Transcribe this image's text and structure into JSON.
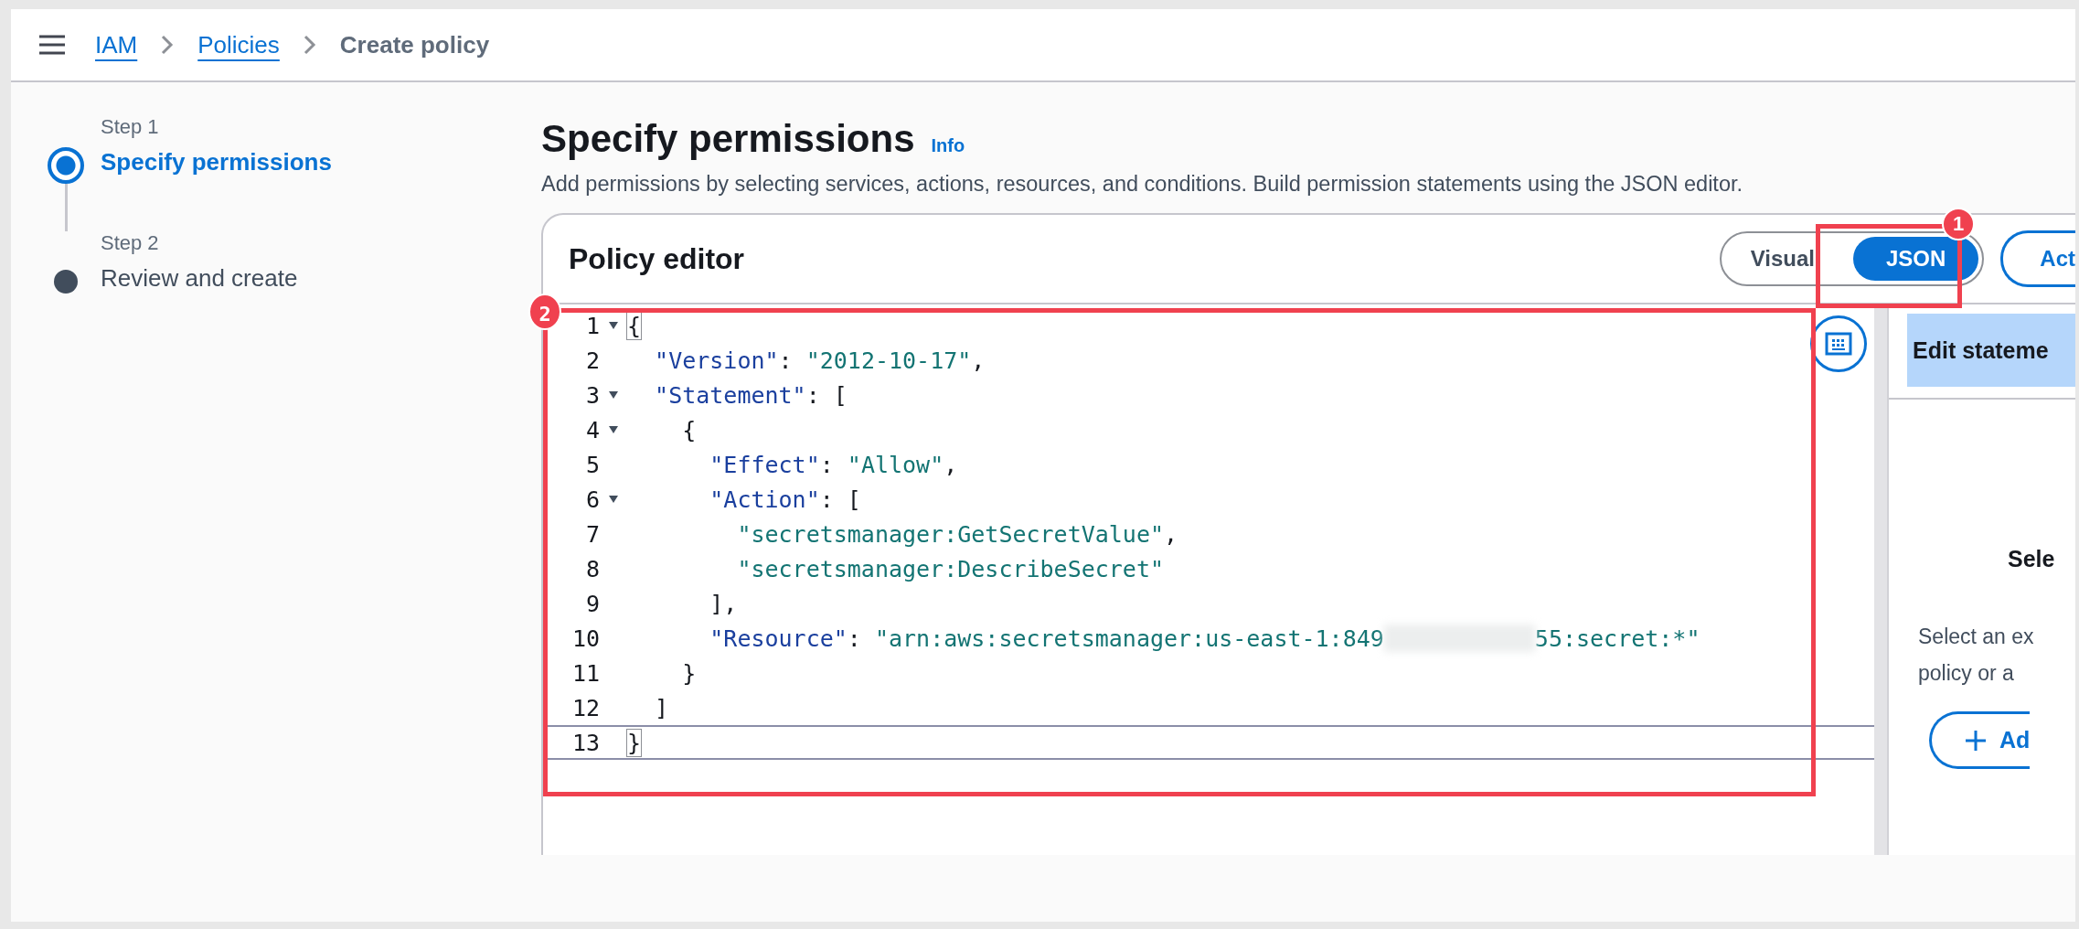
{
  "breadcrumbs": [
    {
      "label": "IAM",
      "kind": "link"
    },
    {
      "label": "Policies",
      "kind": "link"
    },
    {
      "label": "Create policy",
      "kind": "current"
    }
  ],
  "steps": [
    {
      "label": "Step 1",
      "title": "Specify permissions",
      "selected": true
    },
    {
      "label": "Step 2",
      "title": "Review and create",
      "selected": false
    }
  ],
  "page": {
    "title": "Specify permissions",
    "info_link": "Info",
    "description": "Add permissions by selecting services, actions, resources, and conditions. Build permission statements using the JSON editor."
  },
  "editor": {
    "title": "Policy editor",
    "modes": [
      {
        "label": "Visual",
        "selected": false
      },
      {
        "label": "JSON",
        "selected": true
      }
    ],
    "actions_button": "Act",
    "code_lines": [
      {
        "number": "1",
        "foldable": true,
        "active": false,
        "tokens": [
          {
            "kind": "bracket-match",
            "text": "{"
          }
        ]
      },
      {
        "number": "2",
        "foldable": false,
        "active": false,
        "tokens": [
          {
            "kind": "key",
            "text": "\"Version\""
          },
          {
            "kind": "plain",
            "text": ": "
          },
          {
            "kind": "string",
            "text": "\"2012-10-17\""
          },
          {
            "kind": "plain",
            "text": ","
          }
        ]
      },
      {
        "number": "3",
        "foldable": true,
        "active": false,
        "tokens": [
          {
            "kind": "key",
            "text": "\"Statement\""
          },
          {
            "kind": "plain",
            "text": ": ["
          }
        ]
      },
      {
        "number": "4",
        "foldable": true,
        "active": false,
        "tokens": [
          {
            "kind": "plain",
            "text": "{"
          }
        ]
      },
      {
        "number": "5",
        "foldable": false,
        "active": false,
        "tokens": [
          {
            "kind": "key",
            "text": "\"Effect\""
          },
          {
            "kind": "plain",
            "text": ": "
          },
          {
            "kind": "string",
            "text": "\"Allow\""
          },
          {
            "kind": "plain",
            "text": ","
          }
        ]
      },
      {
        "number": "6",
        "foldable": true,
        "active": false,
        "tokens": [
          {
            "kind": "key",
            "text": "\"Action\""
          },
          {
            "kind": "plain",
            "text": ": ["
          }
        ]
      },
      {
        "number": "7",
        "foldable": false,
        "active": false,
        "tokens": [
          {
            "kind": "string",
            "text": "\"secretsmanager:GetSecretValue\""
          },
          {
            "kind": "plain",
            "text": ","
          }
        ]
      },
      {
        "number": "8",
        "foldable": false,
        "active": false,
        "tokens": [
          {
            "kind": "string",
            "text": "\"secretsmanager:DescribeSecret\""
          }
        ]
      },
      {
        "number": "9",
        "foldable": false,
        "active": false,
        "tokens": [
          {
            "kind": "plain",
            "text": "],"
          }
        ]
      },
      {
        "number": "10",
        "foldable": false,
        "active": false,
        "tokens": [
          {
            "kind": "key",
            "text": "\"Resource\""
          },
          {
            "kind": "plain",
            "text": ": "
          },
          {
            "kind": "string",
            "text": "\"arn:aws:secretsmanager:us-east-1:849"
          },
          {
            "kind": "redacted"
          },
          {
            "kind": "string",
            "text": "55:secret:*\""
          }
        ]
      },
      {
        "number": "11",
        "foldable": false,
        "active": false,
        "tokens": [
          {
            "kind": "plain",
            "text": "}"
          }
        ]
      },
      {
        "number": "12",
        "foldable": false,
        "active": false,
        "tokens": [
          {
            "kind": "plain",
            "text": "]"
          }
        ]
      },
      {
        "number": "13",
        "foldable": false,
        "active": true,
        "tokens": [
          {
            "kind": "bracket-match",
            "text": "}"
          }
        ]
      }
    ]
  },
  "side_panel": {
    "tab": "Edit stateme",
    "heading": "Sele",
    "text_lines": [
      "Select an ex",
      "policy or a"
    ],
    "add_button": "Ad"
  },
  "annotations": [
    {
      "number": "1",
      "kind": "mode-toggle"
    },
    {
      "number": "2",
      "kind": "code"
    }
  ]
}
